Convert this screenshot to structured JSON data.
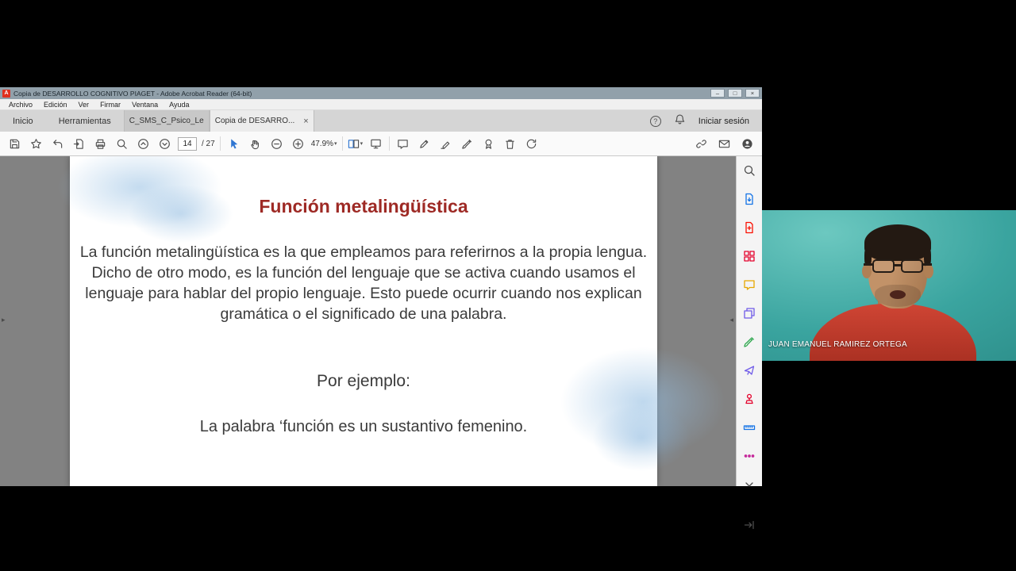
{
  "window": {
    "title": "Copia de DESARROLLO COGNITIVO PIAGET - Adobe Acrobat Reader (64-bit)"
  },
  "icons": {
    "acrobat": "A",
    "minimize": "–",
    "restore": "□",
    "close": "×",
    "close_tab": "×",
    "help": "?",
    "caret_down": "▾",
    "pane_open_right": "▸",
    "pane_close_left": "◂"
  },
  "menubar": {
    "items": [
      "Archivo",
      "Edición",
      "Ver",
      "Firmar",
      "Ventana",
      "Ayuda"
    ]
  },
  "tabbar": {
    "home": "Inicio",
    "tools": "Herramientas",
    "doc_tabs": [
      {
        "label": "C_SMS_C_Psico_Le..."
      },
      {
        "label": "Copia de DESARRO..."
      }
    ],
    "sign_in": "Iniciar sesión"
  },
  "toolbar": {
    "page_current": "14",
    "page_total_label": "/ 27",
    "zoom_level": "47.9%"
  },
  "slide": {
    "title": "Función metalingüística",
    "body": "La función metalingüística es la que empleamos para referirnos a la propia lengua. Dicho de otro modo, es la función del lenguaje que se activa cuando usamos el lenguaje para hablar del propio lenguaje. Esto puede ocurrir cuando nos explican gramática o el significado de una palabra.",
    "example_label": "Por ejemplo:",
    "example_text": "La palabra ‘función es un sustantivo femenino."
  },
  "webcam": {
    "name": "JUAN EMANUEL RAMIREZ ORTEGA"
  },
  "colors": {
    "acrobat_red": "#e0301e",
    "slide_title": "#9e2a25",
    "webcam_teal": "#3aa49f"
  }
}
